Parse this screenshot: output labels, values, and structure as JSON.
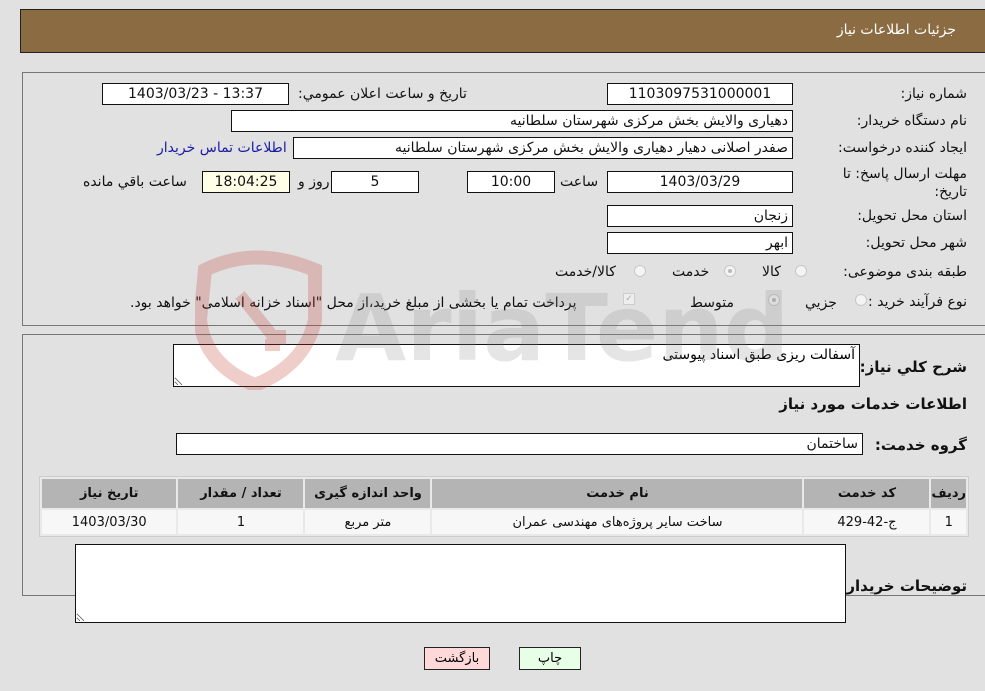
{
  "header": {
    "title": "جزئیات اطلاعات نیاز"
  },
  "details": {
    "need_number_label": "شماره نیاز:",
    "need_number": "1103097531000001",
    "announce_label": "تاریخ و ساعت اعلان عمومي:",
    "announce_value": "1403/03/23 - 13:37",
    "buyer_org_label": "نام دستگاه خریدار:",
    "buyer_org": "دهیاری والایش بخش مرکزی شهرستان سلطانیه",
    "creator_label": "ایجاد کننده درخواست:",
    "creator": "صفدر اصلانی دهیار دهیاری والایش بخش مرکزی شهرستان سلطانیه",
    "buyer_contact_link": "اطلاعات تماس خریدار",
    "deadline_label": "مهلت ارسال پاسخ: تا تاریخ:",
    "deadline_date": "1403/03/29",
    "time_label": "ساعت",
    "deadline_time": "10:00",
    "days_value": "5",
    "days_label": "روز و",
    "remaining_time": "18:04:25",
    "remaining_label": "ساعت باقي مانده",
    "province_label": "استان محل تحویل:",
    "province": "زنجان",
    "city_label": "شهر محل تحویل:",
    "city": "ابهر",
    "category_label": "طبقه بندی موضوعی:",
    "category_options": [
      {
        "label": "کالا",
        "selected": false
      },
      {
        "label": "خدمت",
        "selected": true
      },
      {
        "label": "کالا/خدمت",
        "selected": false
      }
    ],
    "process_label": "نوع فرآیند خرید :",
    "process_options": [
      {
        "label": "جزیي",
        "selected": false
      },
      {
        "label": "متوسط",
        "selected": true
      }
    ],
    "treasury_note": "پرداخت تمام یا بخشی از مبلغ خرید،از محل \"اسناد خزانه اسلامی\" خواهد بود.",
    "treasury_checked": true
  },
  "summary": {
    "description_label": "شرح کلي نیاز:",
    "description": "آسفالت ریزی طبق اسناد پیوستی",
    "services_heading": "اطلاعات خدمات مورد نیاز",
    "service_group_label": "گروه خدمت:",
    "service_group": "ساختمان"
  },
  "table": {
    "columns": [
      "ردیف",
      "کد خدمت",
      "نام خدمت",
      "واحد اندازه گیری",
      "تعداد / مقدار",
      "تاریخ نیاز"
    ],
    "rows": [
      [
        "1",
        "ج-42-429",
        "ساخت سایر پروژه‌های مهندسی عمران",
        "متر مربع",
        "1",
        "1403/03/30"
      ]
    ]
  },
  "buyer_notes": {
    "label": "توضیحات خریدار:",
    "value": ""
  },
  "buttons": {
    "back": "بازگشت",
    "print": "چاپ"
  },
  "watermark": {
    "text": "AriaTender.net",
    "accent_color": "#c0392b"
  },
  "colors": {
    "header_bg": "#8b6b42",
    "page_bg": "#e1e1e1",
    "link": "#1a1aa8"
  }
}
